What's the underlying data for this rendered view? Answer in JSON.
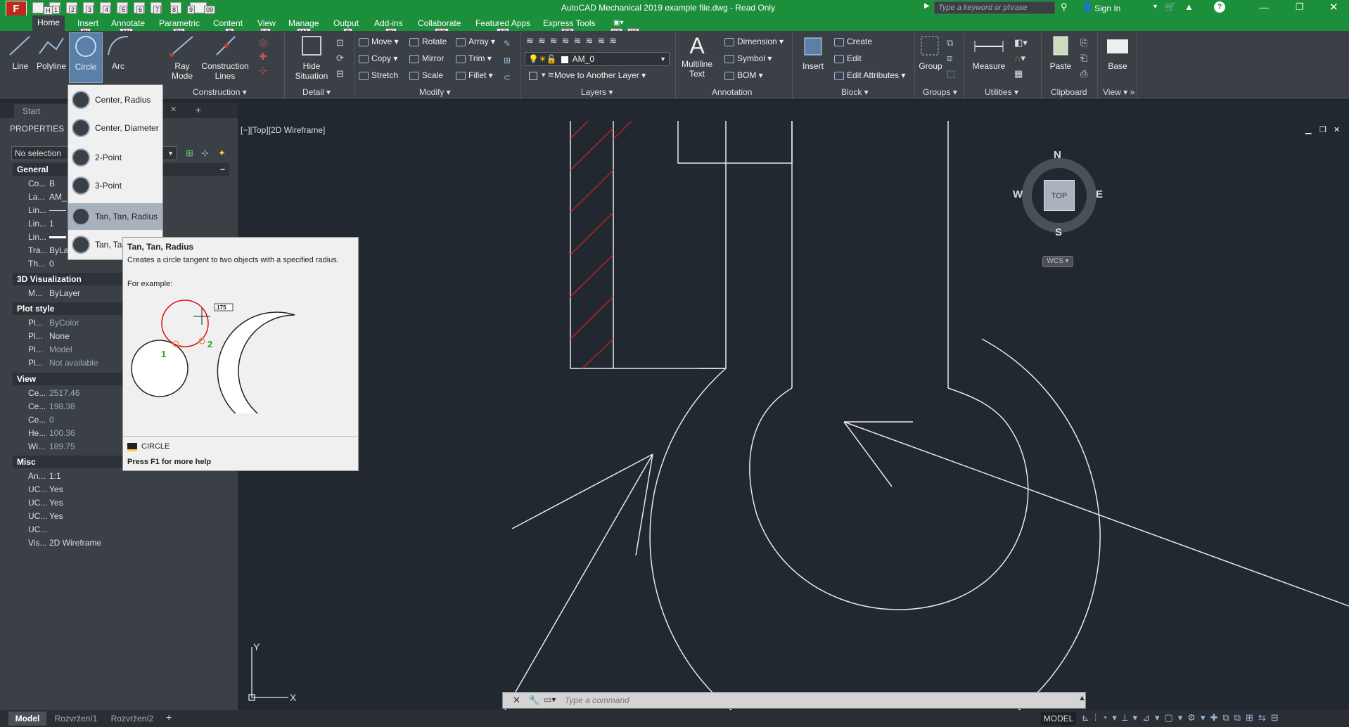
{
  "window": {
    "title": "AutoCAD Mechanical 2019    example file.dwg - Read Only",
    "app_logo": "F",
    "search_placeholder": "Type a keyword or phrase",
    "sign_in": "Sign In",
    "quick_access_tips": [
      "H",
      "1",
      "2",
      "3",
      "4",
      "5",
      "6",
      "7",
      "8",
      "9",
      "0",
      "09"
    ]
  },
  "ribbon_tabs": [
    {
      "label": "Home",
      "key": "H"
    },
    {
      "label": "Insert",
      "key": "IN"
    },
    {
      "label": "Annotate",
      "key": "AN"
    },
    {
      "label": "Parametric",
      "key": "PA"
    },
    {
      "label": "Content",
      "key": "C"
    },
    {
      "label": "View",
      "key": "VI"
    },
    {
      "label": "Manage",
      "key": "MA"
    },
    {
      "label": "Output",
      "key": "O"
    },
    {
      "label": "Add-ins",
      "key": "GI"
    },
    {
      "label": "Collaborate",
      "key": "CO"
    },
    {
      "label": "Featured Apps",
      "key": "AP"
    },
    {
      "label": "Express Tools",
      "key": "ET"
    }
  ],
  "extra_key_tips": [
    "X2",
    "X3"
  ],
  "ribbon": {
    "draw": {
      "line": "Line",
      "polyline": "Polyline",
      "circle": "Circle",
      "arc": "Arc"
    },
    "ray_mode": {
      "line1": "Ray",
      "line2": "Mode"
    },
    "construction_lines": {
      "line1": "Construction",
      "line2": "Lines"
    },
    "hide_situation": {
      "line1": "Hide",
      "line2": "Situation"
    },
    "modify": {
      "move": "Move",
      "rotate": "Rotate",
      "array": "Array",
      "copy": "Copy",
      "mirror": "Mirror",
      "trim": "Trim",
      "stretch": "Stretch",
      "scale": "Scale",
      "fillet": "Fillet"
    },
    "layers": {
      "current_layer": "AM_0",
      "move_to_layer": "Move to Another Layer"
    },
    "annotation": {
      "multiline_line1": "Multiline",
      "multiline_line2": "Text",
      "dimension": "Dimension",
      "symbol": "Symbol",
      "bom": "BOM"
    },
    "block": {
      "insert": "Insert",
      "create": "Create",
      "edit": "Edit",
      "edit_attributes": "Edit Attributes"
    },
    "groups": {
      "group": "Group"
    },
    "utilities": {
      "measure": "Measure"
    },
    "clipboard": {
      "paste": "Paste"
    },
    "view": {
      "base": "Base"
    },
    "panel_titles": {
      "construction": "Construction",
      "detail": "Detail",
      "modify": "Modify",
      "layers": "Layers",
      "annotation": "Annotation",
      "block": "Block",
      "groups": "Groups",
      "utilities": "Utilities",
      "clipboard": "Clipboard",
      "view": "View"
    }
  },
  "file_tabs": {
    "start": "Start"
  },
  "properties_palette": {
    "title": "PROPERTIES",
    "selection": "No selection",
    "categories": {
      "general": "General",
      "viz3d": "3D Visualization",
      "plot": "Plot style",
      "view": "View",
      "misc": "Misc"
    },
    "general": [
      {
        "name": "Co...",
        "value": "B"
      },
      {
        "name": "La...",
        "value": "AM_"
      },
      {
        "name": "Lin...",
        "value": ""
      },
      {
        "name": "Lin...",
        "value": "1"
      },
      {
        "name": "Lin...",
        "value": ""
      },
      {
        "name": "Tra...",
        "value": "ByLa"
      },
      {
        "name": "Th...",
        "value": "0"
      }
    ],
    "viz3d": [
      {
        "name": "M...",
        "value": "ByLayer"
      }
    ],
    "plot": [
      {
        "name": "Pl...",
        "value": "ByColor"
      },
      {
        "name": "Pl...",
        "value": "None"
      },
      {
        "name": "Pl...",
        "value": "Model"
      },
      {
        "name": "Pl...",
        "value": "Not available"
      }
    ],
    "view": [
      {
        "name": "Ce...",
        "value": "2517.46"
      },
      {
        "name": "Ce...",
        "value": "198.38"
      },
      {
        "name": "Ce...",
        "value": "0"
      },
      {
        "name": "He...",
        "value": "100.36"
      },
      {
        "name": "Wi...",
        "value": "189.75"
      }
    ],
    "misc": [
      {
        "name": "An...",
        "value": "1:1"
      },
      {
        "name": "UC...",
        "value": "Yes"
      },
      {
        "name": "UC...",
        "value": "Yes"
      },
      {
        "name": "UC...",
        "value": "Yes"
      },
      {
        "name": "UC...",
        "value": ""
      },
      {
        "name": "Vis...",
        "value": "2D Wireframe"
      }
    ]
  },
  "circle_menu": [
    "Center, Radius",
    "Center, Diameter",
    "2-Point",
    "3-Point",
    "Tan, Tan, Radius",
    "Tan, Tan"
  ],
  "tooltip": {
    "title": "Tan, Tan, Radius",
    "description": "Creates a circle tangent to two objects with a specified radius.",
    "example_label": "For example:",
    "dim_value": ".175",
    "point1": "1",
    "point2": "2",
    "command": "CIRCLE",
    "help": "Press F1 for more help"
  },
  "viewport": {
    "label": "[−][Top][2D Wireframe]",
    "compass": {
      "n": "N",
      "s": "S",
      "e": "E",
      "w": "W",
      "top": "TOP"
    },
    "wcs": "WCS",
    "ucs_y": "Y",
    "ucs_x": "X"
  },
  "command_line": {
    "placeholder": "Type  a  command"
  },
  "layout_tabs": [
    "Model",
    "Rozvržení1",
    "Rozvržení2"
  ],
  "status": {
    "model": "MODEL"
  },
  "colors": {
    "title_green": "#1c8f3a",
    "ribbon": "#3b4047",
    "canvas": "#212830",
    "hatch": "#cc1f1f"
  }
}
